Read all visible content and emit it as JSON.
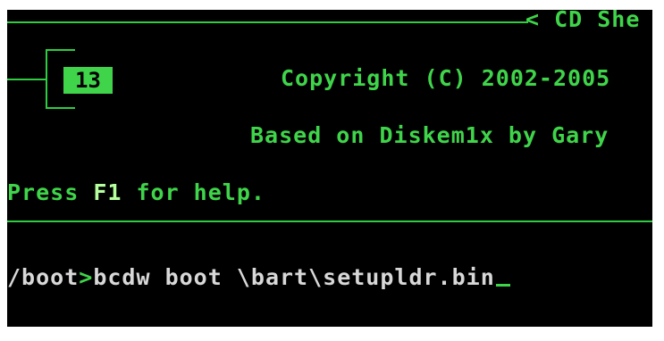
{
  "header": {
    "title": "< CD She",
    "copyright": "Copyright (C) 2002-2005",
    "based_on": "Based on Diskem1x by Gary",
    "badge_number": "13"
  },
  "help": {
    "prefix": "Press ",
    "key": "F1",
    "suffix": " for help."
  },
  "console": {
    "path": "/boot",
    "prompt_symbol": ">",
    "command": "bcdw boot \\bart\\setupldr.bin"
  },
  "colors": {
    "background": "#000000",
    "accent": "#3fd44a",
    "text": "#d8d8d8"
  }
}
